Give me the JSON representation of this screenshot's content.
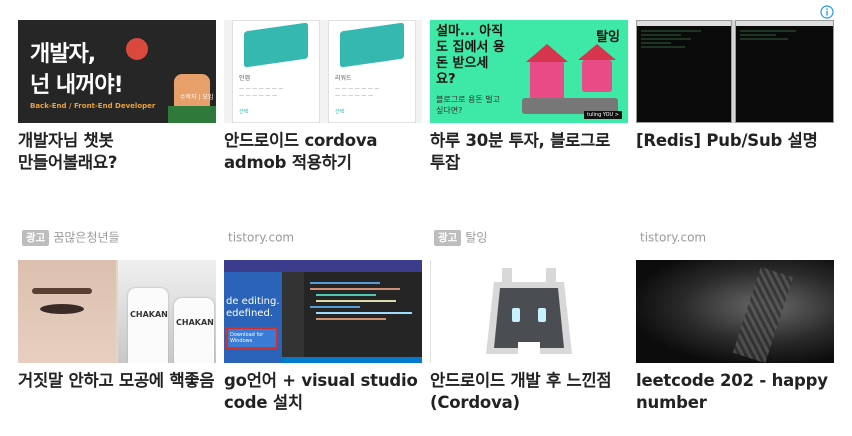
{
  "cards": [
    {
      "title": "개발자님 챗봇 만들어볼래요?",
      "thumb": {
        "line1": "개발자,",
        "line2": "넌 내꺼야!",
        "subtitle": "Back-End / Front-End Developer",
        "tag": "수학자 | 모임"
      }
    },
    {
      "title": "안드로이드 cordova admob 적용하기",
      "thumb": {
        "panel1_title": "인앱",
        "panel2_title": "리워드",
        "panel1_link": "선택",
        "panel2_link": "선택"
      }
    },
    {
      "title": "하루 30분 투자, 블로그로 투잡",
      "thumb": {
        "headline": "설마... 아직도 집에서 용돈 받으세요?",
        "sub": "블로그로 용돈 벌고 싶다면?",
        "brand": "탈잉",
        "cta": "tuling YOU >"
      }
    },
    {
      "title": "[Redis] Pub/Sub 설명",
      "thumb": {}
    },
    {
      "title": "거짓말 안하고 모공에 핵좋음",
      "thumb": {
        "bottle_label": "CHAKAN"
      }
    },
    {
      "title": "go언어 + visual studio code 설치",
      "thumb": {
        "line1": "de editing.",
        "line2": "edefined.",
        "button": "Download for Windows"
      }
    },
    {
      "title": "안드로이드 개발 후 느낀점(Cordova)",
      "thumb": {}
    },
    {
      "title": "leetcode 202 - happy number",
      "thumb": {}
    }
  ],
  "sources": [
    {
      "ad": "광고",
      "text": "꿈많은청년들"
    },
    {
      "ad": "",
      "text": "tistory.com"
    },
    {
      "ad": "광고",
      "text": "탈잉"
    },
    {
      "ad": "",
      "text": "tistory.com"
    }
  ],
  "colors": {
    "ad_badge": "#bdbdbd",
    "info_icon": "#2196f3",
    "title": "#222222",
    "source": "#9a9a9a"
  }
}
